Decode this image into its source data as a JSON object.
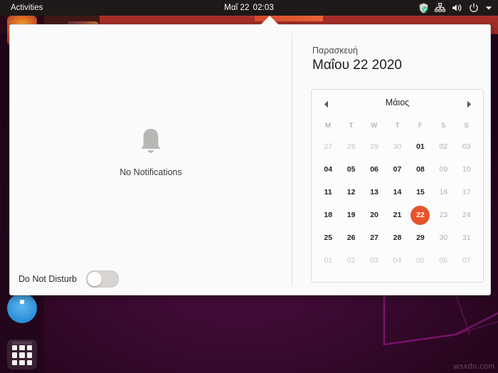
{
  "topbar": {
    "activities_label": "Activities",
    "clock_date": "Μαΐ 22",
    "clock_time": "02:03",
    "icons": [
      "shield-icon",
      "network-icon",
      "volume-icon",
      "power-icon",
      "chevron-down-icon"
    ]
  },
  "notifications": {
    "empty_text": "No Notifications",
    "empty_icon": "bell-icon",
    "do_not_disturb_label": "Do Not Disturb",
    "do_not_disturb_on": false
  },
  "calendar": {
    "day_name": "Παρασκευή",
    "full_date": "Μαΐου 22 2020",
    "month_name": "Μάιος",
    "prev_icon": "chevron-left-icon",
    "next_icon": "chevron-right-icon",
    "weekday_headers": [
      "M",
      "T",
      "W",
      "T",
      "F",
      "S",
      "S"
    ],
    "selected_day": "22",
    "accent_color": "#e8532a",
    "weeks": [
      [
        {
          "label": "27",
          "type": "other"
        },
        {
          "label": "28",
          "type": "other"
        },
        {
          "label": "29",
          "type": "other"
        },
        {
          "label": "30",
          "type": "other"
        },
        {
          "label": "01",
          "type": "weekday"
        },
        {
          "label": "02",
          "type": "weekend"
        },
        {
          "label": "03",
          "type": "weekend"
        }
      ],
      [
        {
          "label": "04",
          "type": "weekday"
        },
        {
          "label": "05",
          "type": "weekday"
        },
        {
          "label": "06",
          "type": "weekday"
        },
        {
          "label": "07",
          "type": "weekday"
        },
        {
          "label": "08",
          "type": "weekday"
        },
        {
          "label": "09",
          "type": "weekend"
        },
        {
          "label": "10",
          "type": "weekend"
        }
      ],
      [
        {
          "label": "11",
          "type": "weekday"
        },
        {
          "label": "12",
          "type": "weekday"
        },
        {
          "label": "13",
          "type": "weekday"
        },
        {
          "label": "14",
          "type": "weekday"
        },
        {
          "label": "15",
          "type": "weekday"
        },
        {
          "label": "16",
          "type": "weekend"
        },
        {
          "label": "17",
          "type": "weekend"
        }
      ],
      [
        {
          "label": "18",
          "type": "weekday"
        },
        {
          "label": "19",
          "type": "weekday"
        },
        {
          "label": "20",
          "type": "weekday"
        },
        {
          "label": "21",
          "type": "weekday"
        },
        {
          "label": "22",
          "type": "today"
        },
        {
          "label": "23",
          "type": "weekend"
        },
        {
          "label": "24",
          "type": "weekend"
        }
      ],
      [
        {
          "label": "25",
          "type": "weekday"
        },
        {
          "label": "26",
          "type": "weekday"
        },
        {
          "label": "27",
          "type": "weekday"
        },
        {
          "label": "28",
          "type": "weekday"
        },
        {
          "label": "29",
          "type": "weekday"
        },
        {
          "label": "30",
          "type": "weekend"
        },
        {
          "label": "31",
          "type": "weekend"
        }
      ],
      [
        {
          "label": "01",
          "type": "other"
        },
        {
          "label": "02",
          "type": "other"
        },
        {
          "label": "03",
          "type": "other"
        },
        {
          "label": "04",
          "type": "other"
        },
        {
          "label": "05",
          "type": "other"
        },
        {
          "label": "06",
          "type": "other"
        },
        {
          "label": "07",
          "type": "other"
        }
      ]
    ]
  },
  "dock": {
    "items": [
      "firefox-icon",
      "files-icon",
      "show-applications-icon"
    ]
  },
  "watermark": "wsxdn.com"
}
